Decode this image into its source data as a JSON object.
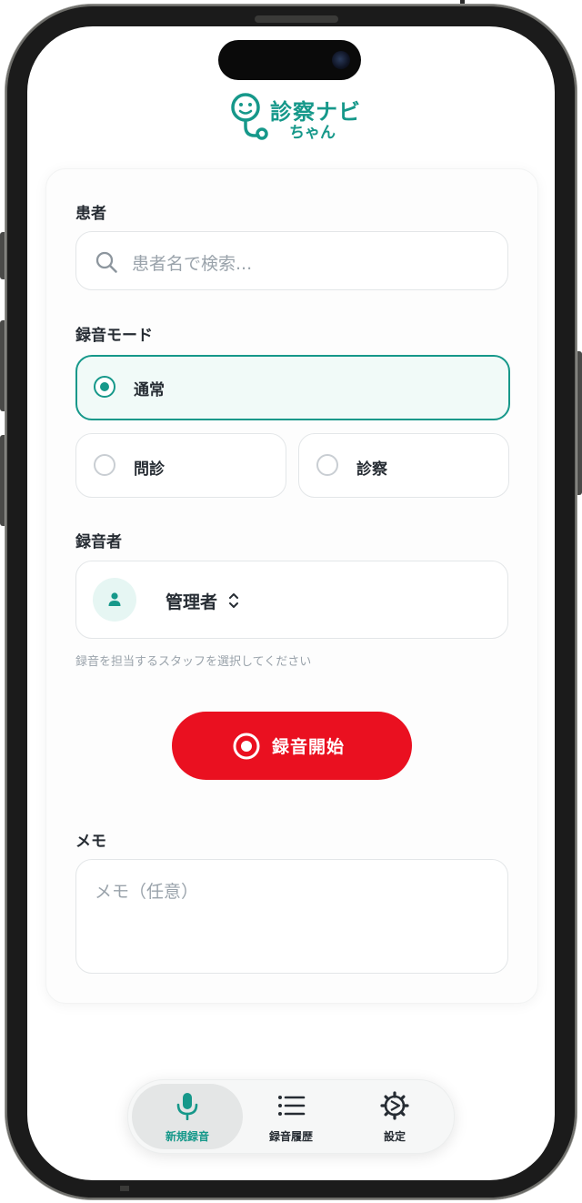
{
  "app": {
    "logo_title": "診察ナビ",
    "logo_subtitle": "ちゃん",
    "brand_color": "#16988a",
    "danger_color": "#ea1020"
  },
  "patient": {
    "label": "患者",
    "search_placeholder": "患者名で検索..."
  },
  "mode": {
    "label": "録音モード",
    "options": [
      {
        "label": "通常",
        "selected": true
      },
      {
        "label": "問診",
        "selected": false
      },
      {
        "label": "診察",
        "selected": false
      }
    ]
  },
  "recorder": {
    "label": "録音者",
    "selected": "管理者",
    "helper_text": "録音を担当するスタッフを選択してください"
  },
  "record_button": {
    "label": "録音開始"
  },
  "memo": {
    "label": "メモ",
    "placeholder": "メモ（任意）"
  },
  "tabbar": {
    "items": [
      {
        "label": "新規録音",
        "icon": "mic-icon",
        "active": true
      },
      {
        "label": "録音履歴",
        "icon": "list-icon",
        "active": false
      },
      {
        "label": "設定",
        "icon": "gear-icon",
        "active": false
      }
    ]
  }
}
